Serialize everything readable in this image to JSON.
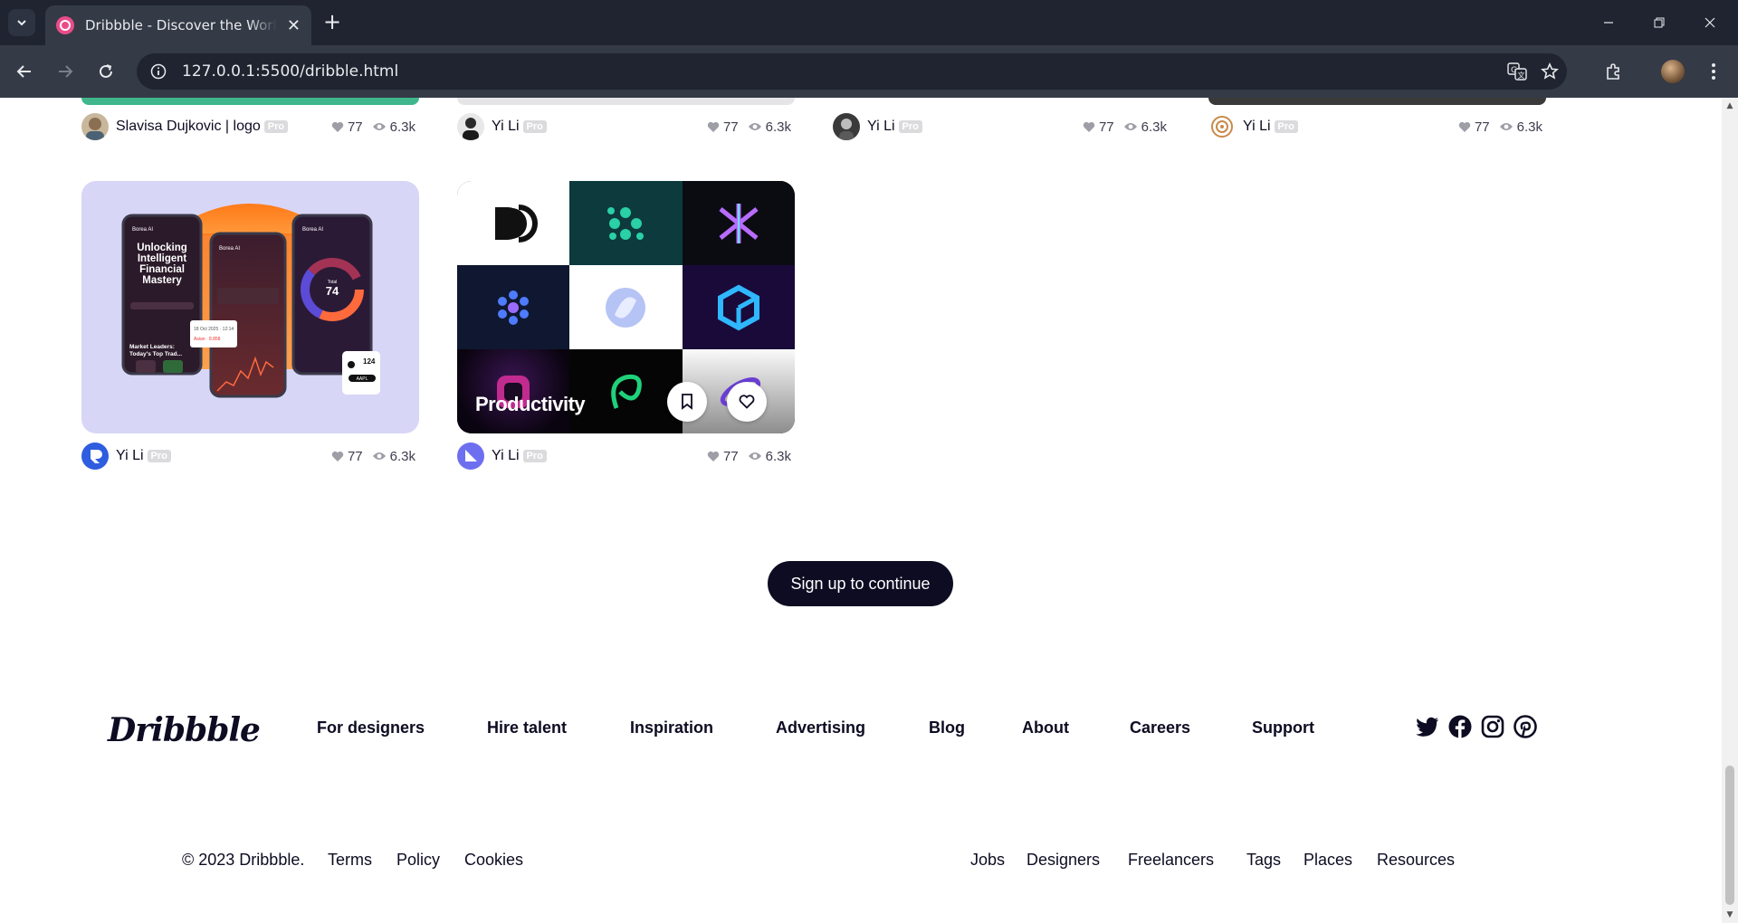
{
  "browser": {
    "tab_title": "Dribbble - Discover the World's",
    "new_tab": "+",
    "url": "127.0.0.1:5500/dribble.html"
  },
  "shots_row_prev": [
    {
      "author": "Slavisa Dujkovic | logo",
      "pro": "Pro",
      "likes": "77",
      "views": "6.3k"
    },
    {
      "author": "Yi Li",
      "pro": "Pro",
      "likes": "77",
      "views": "6.3k"
    },
    {
      "author": "Yi Li",
      "pro": "Pro",
      "likes": "77",
      "views": "6.3k"
    },
    {
      "author": "Yi Li",
      "pro": "Pro",
      "likes": "77",
      "views": "6.3k"
    }
  ],
  "shots_row": [
    {
      "author": "Yi Li",
      "pro": "Pro",
      "likes": "77",
      "views": "6.3k"
    },
    {
      "author": "Yi Li",
      "pro": "Pro",
      "likes": "77",
      "views": "6.3k"
    }
  ],
  "shot_a": {
    "app_name": "Borea AI",
    "headline": "Unlocking Intelligent Financial Mastery",
    "market_text": "Market Leaders: Today's Top Trad...",
    "total_label": "Total",
    "total_value": "74",
    "stock_value": "124",
    "stock_ticker": "AAPL"
  },
  "shot_b": {
    "overlay_text": "Productivity"
  },
  "cta": {
    "label": "Sign up to continue"
  },
  "footer": {
    "logo": "Dribbble",
    "nav": [
      "For designers",
      "Hire talent",
      "Inspiration",
      "Advertising",
      "Blog",
      "About",
      "Careers",
      "Support"
    ],
    "copyright": "© 2023 Dribbble.",
    "legal": [
      "Terms",
      "Policy",
      "Cookies"
    ],
    "links": [
      "Jobs",
      "Designers",
      "Freelancers",
      "Tags",
      "Places",
      "Resources"
    ]
  }
}
